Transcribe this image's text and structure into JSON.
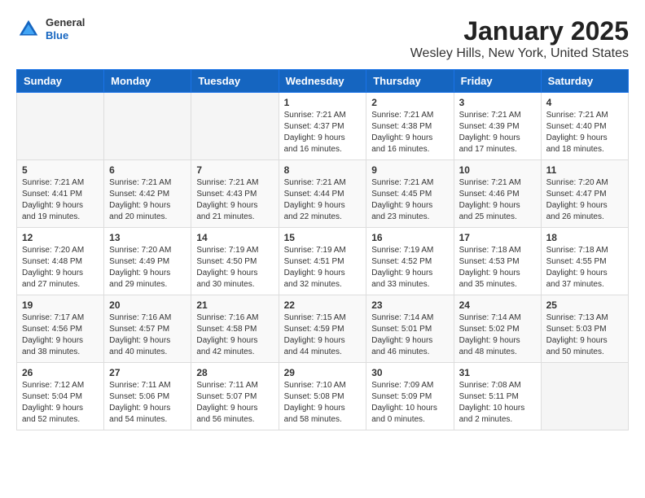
{
  "header": {
    "logo": {
      "general": "General",
      "blue": "Blue"
    },
    "title": "January 2025",
    "location": "Wesley Hills, New York, United States"
  },
  "weekdays": [
    "Sunday",
    "Monday",
    "Tuesday",
    "Wednesday",
    "Thursday",
    "Friday",
    "Saturday"
  ],
  "weeks": [
    [
      {
        "day": "",
        "info": ""
      },
      {
        "day": "",
        "info": ""
      },
      {
        "day": "",
        "info": ""
      },
      {
        "day": "1",
        "info": "Sunrise: 7:21 AM\nSunset: 4:37 PM\nDaylight: 9 hours\nand 16 minutes."
      },
      {
        "day": "2",
        "info": "Sunrise: 7:21 AM\nSunset: 4:38 PM\nDaylight: 9 hours\nand 16 minutes."
      },
      {
        "day": "3",
        "info": "Sunrise: 7:21 AM\nSunset: 4:39 PM\nDaylight: 9 hours\nand 17 minutes."
      },
      {
        "day": "4",
        "info": "Sunrise: 7:21 AM\nSunset: 4:40 PM\nDaylight: 9 hours\nand 18 minutes."
      }
    ],
    [
      {
        "day": "5",
        "info": "Sunrise: 7:21 AM\nSunset: 4:41 PM\nDaylight: 9 hours\nand 19 minutes."
      },
      {
        "day": "6",
        "info": "Sunrise: 7:21 AM\nSunset: 4:42 PM\nDaylight: 9 hours\nand 20 minutes."
      },
      {
        "day": "7",
        "info": "Sunrise: 7:21 AM\nSunset: 4:43 PM\nDaylight: 9 hours\nand 21 minutes."
      },
      {
        "day": "8",
        "info": "Sunrise: 7:21 AM\nSunset: 4:44 PM\nDaylight: 9 hours\nand 22 minutes."
      },
      {
        "day": "9",
        "info": "Sunrise: 7:21 AM\nSunset: 4:45 PM\nDaylight: 9 hours\nand 23 minutes."
      },
      {
        "day": "10",
        "info": "Sunrise: 7:21 AM\nSunset: 4:46 PM\nDaylight: 9 hours\nand 25 minutes."
      },
      {
        "day": "11",
        "info": "Sunrise: 7:20 AM\nSunset: 4:47 PM\nDaylight: 9 hours\nand 26 minutes."
      }
    ],
    [
      {
        "day": "12",
        "info": "Sunrise: 7:20 AM\nSunset: 4:48 PM\nDaylight: 9 hours\nand 27 minutes."
      },
      {
        "day": "13",
        "info": "Sunrise: 7:20 AM\nSunset: 4:49 PM\nDaylight: 9 hours\nand 29 minutes."
      },
      {
        "day": "14",
        "info": "Sunrise: 7:19 AM\nSunset: 4:50 PM\nDaylight: 9 hours\nand 30 minutes."
      },
      {
        "day": "15",
        "info": "Sunrise: 7:19 AM\nSunset: 4:51 PM\nDaylight: 9 hours\nand 32 minutes."
      },
      {
        "day": "16",
        "info": "Sunrise: 7:19 AM\nSunset: 4:52 PM\nDaylight: 9 hours\nand 33 minutes."
      },
      {
        "day": "17",
        "info": "Sunrise: 7:18 AM\nSunset: 4:53 PM\nDaylight: 9 hours\nand 35 minutes."
      },
      {
        "day": "18",
        "info": "Sunrise: 7:18 AM\nSunset: 4:55 PM\nDaylight: 9 hours\nand 37 minutes."
      }
    ],
    [
      {
        "day": "19",
        "info": "Sunrise: 7:17 AM\nSunset: 4:56 PM\nDaylight: 9 hours\nand 38 minutes."
      },
      {
        "day": "20",
        "info": "Sunrise: 7:16 AM\nSunset: 4:57 PM\nDaylight: 9 hours\nand 40 minutes."
      },
      {
        "day": "21",
        "info": "Sunrise: 7:16 AM\nSunset: 4:58 PM\nDaylight: 9 hours\nand 42 minutes."
      },
      {
        "day": "22",
        "info": "Sunrise: 7:15 AM\nSunset: 4:59 PM\nDaylight: 9 hours\nand 44 minutes."
      },
      {
        "day": "23",
        "info": "Sunrise: 7:14 AM\nSunset: 5:01 PM\nDaylight: 9 hours\nand 46 minutes."
      },
      {
        "day": "24",
        "info": "Sunrise: 7:14 AM\nSunset: 5:02 PM\nDaylight: 9 hours\nand 48 minutes."
      },
      {
        "day": "25",
        "info": "Sunrise: 7:13 AM\nSunset: 5:03 PM\nDaylight: 9 hours\nand 50 minutes."
      }
    ],
    [
      {
        "day": "26",
        "info": "Sunrise: 7:12 AM\nSunset: 5:04 PM\nDaylight: 9 hours\nand 52 minutes."
      },
      {
        "day": "27",
        "info": "Sunrise: 7:11 AM\nSunset: 5:06 PM\nDaylight: 9 hours\nand 54 minutes."
      },
      {
        "day": "28",
        "info": "Sunrise: 7:11 AM\nSunset: 5:07 PM\nDaylight: 9 hours\nand 56 minutes."
      },
      {
        "day": "29",
        "info": "Sunrise: 7:10 AM\nSunset: 5:08 PM\nDaylight: 9 hours\nand 58 minutes."
      },
      {
        "day": "30",
        "info": "Sunrise: 7:09 AM\nSunset: 5:09 PM\nDaylight: 10 hours\nand 0 minutes."
      },
      {
        "day": "31",
        "info": "Sunrise: 7:08 AM\nSunset: 5:11 PM\nDaylight: 10 hours\nand 2 minutes."
      },
      {
        "day": "",
        "info": ""
      }
    ]
  ]
}
